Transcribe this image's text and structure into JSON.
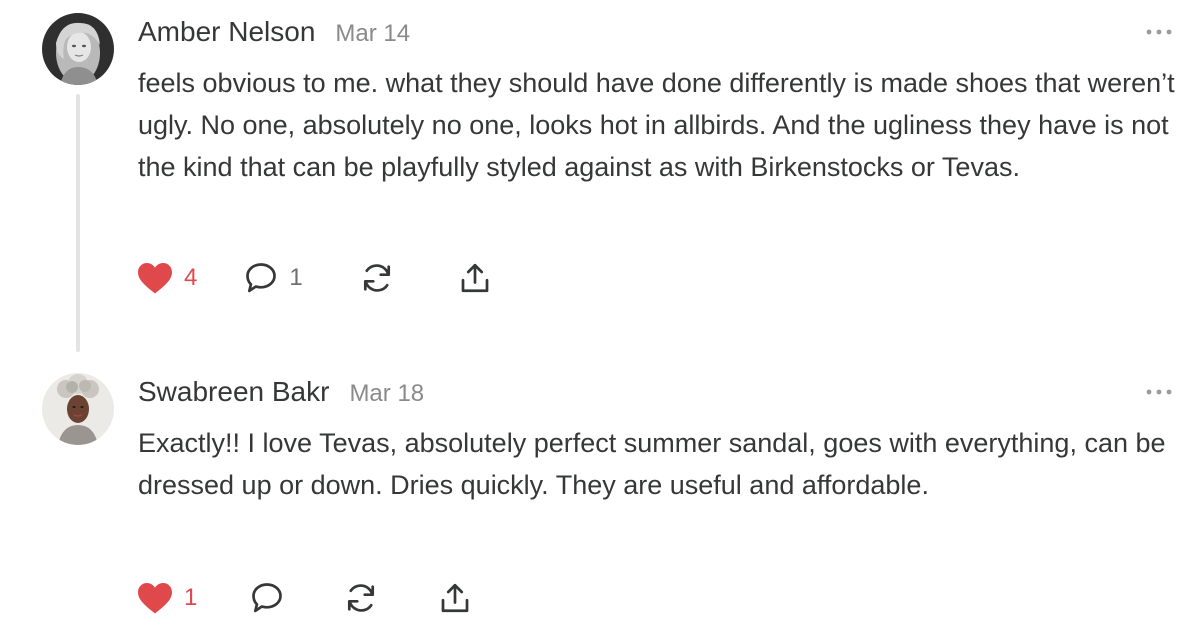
{
  "comments": [
    {
      "author": "Amber Nelson",
      "date": "Mar 14",
      "avatar_icon": "avatar-woman-blonde-grayscale",
      "text": "feels obvious to me. what they should have done differently is made shoes that weren’t ugly. No one, absolutely no one, looks hot in allbirds. And the ugliness they have is not the kind that can be playfully styled against as with Birkenstocks or Tevas.",
      "likes": "4",
      "replies": "1",
      "liked": true
    },
    {
      "author": "Swabreen Bakr",
      "date": "Mar 18",
      "avatar_icon": "avatar-woman-curly-hair",
      "text": "Exactly!! I love Tevas, absolutely perfect summer sandal, goes with everything, can be dressed up or down. Dries quickly. They are useful and affordable.",
      "likes": "1",
      "replies": "",
      "liked": true
    }
  ],
  "colors": {
    "like": "#e0494c",
    "icon": "#363737",
    "text": "#363737",
    "muted": "#8a8a8a",
    "thread_line": "#e3e3e3"
  },
  "icons": {
    "like": "heart-icon",
    "reply": "comment-bubble-icon",
    "restack": "restack-icon",
    "share": "share-icon",
    "more": "ellipsis-icon"
  }
}
